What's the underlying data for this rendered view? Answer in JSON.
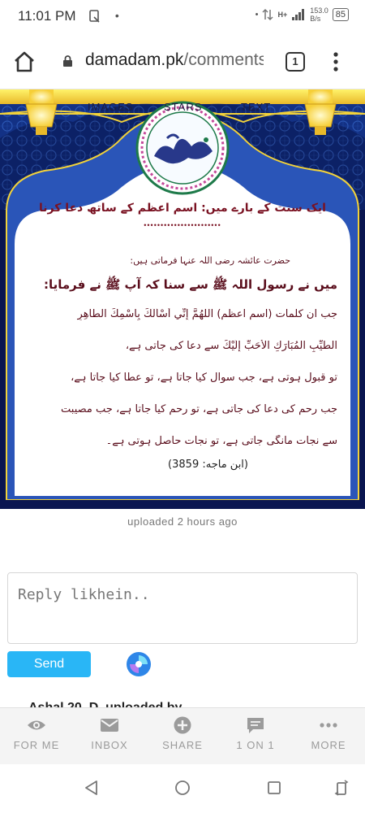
{
  "status_bar": {
    "time": "11:01 PM",
    "network": "H+",
    "speed_value": "153.0",
    "speed_unit": "B/s",
    "battery": "85"
  },
  "browser": {
    "url_domain": "damadam.pk",
    "url_path": "/comments",
    "tab_count": "1"
  },
  "banner": {
    "nav": [
      "IMAGES",
      "STARS",
      "TEXT"
    ],
    "title_urdu": "ایک سنت کے بارے میں: اسم اعظم کے ساتھ دعا کرنا",
    "dots": "•••••••••••••••••••••••",
    "lines_urdu": [
      "حضرت عائشہ رضی اللہ عنہا فرماتی ہیں:",
      "میں نے رسول اللہ ﷺ سے سنا کہ آپ ﷺ نے فرمایا:",
      "جب ان کلمات (اسم اعظم) اللّٰهُمَّ إِنِّي أَسْأَلُكَ بِاسْمِكَ الطَّاهِرِ",
      "الطَّيِّبِ الْمُبَارَكِ الْأَحَبِّ إِلَيْكَ سے دعا کی جاتی ہے،",
      "تو قبول ہوتی ہے، جب سوال کیا جاتا ہے، تو عطا کیا جاتا ہے،",
      "جب رحم کی دعا کی جاتی ہے، تو رحم کیا جاتا ہے، جب مصیبت",
      "سے نجات مانگی جاتی ہے، تو نجات حاصل ہوتی ہے۔"
    ],
    "reference": "(ابن ماجه: 3859)"
  },
  "caption": "uploaded 2 hours ago",
  "reply": {
    "placeholder": "Reply likhein..",
    "send_label": "Send"
  },
  "peek_text": "Ashal 20. D. uploaded by ...",
  "bottom_nav": [
    {
      "label": "FOR ME",
      "icon": "eye-icon"
    },
    {
      "label": "INBOX",
      "icon": "envelope-icon"
    },
    {
      "label": "SHARE",
      "icon": "plus-circle-icon"
    },
    {
      "label": "1 ON 1",
      "icon": "chat-bubble-icon"
    },
    {
      "label": "MORE",
      "icon": "more-dots-icon"
    }
  ],
  "colors": {
    "accent": "#29b6f6",
    "banner_navy": "#0c1a5a",
    "banner_gold": "#f2d23a",
    "urdu_text": "#5a0e1c"
  }
}
